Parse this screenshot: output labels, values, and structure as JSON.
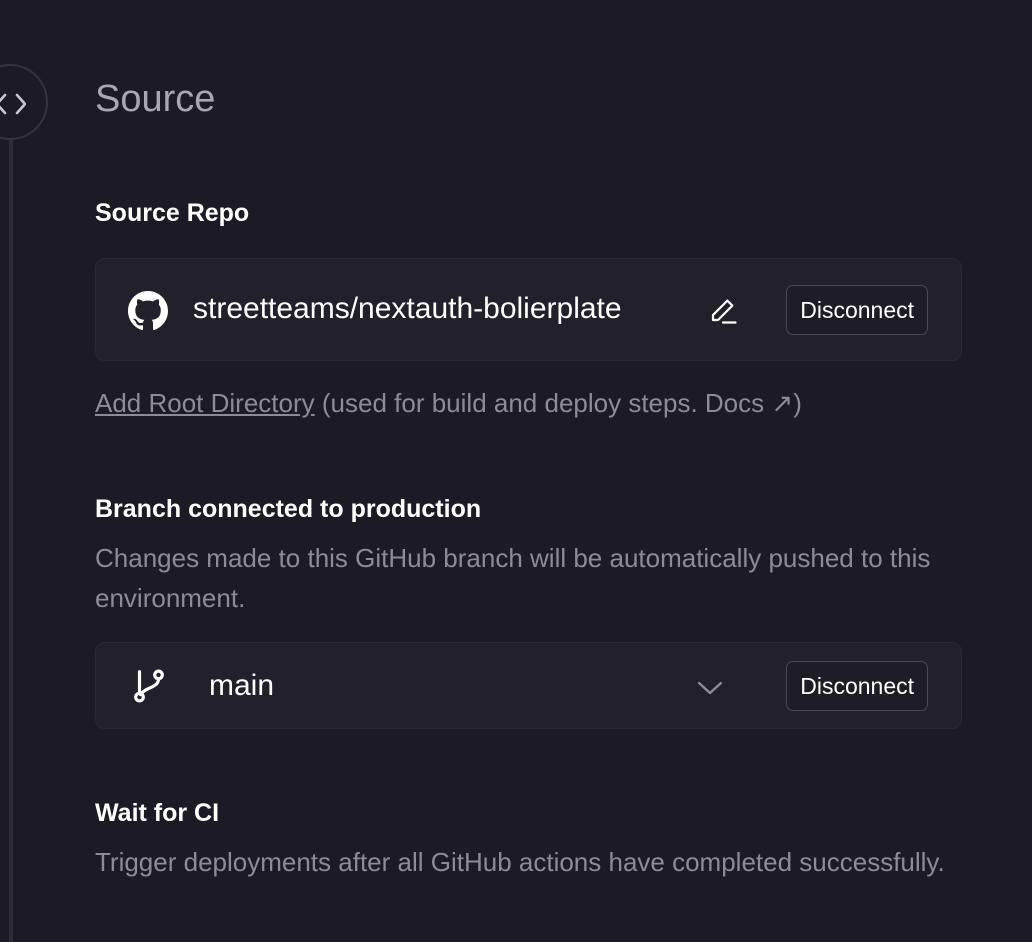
{
  "section": {
    "title": "Source",
    "icon": "code-brackets-icon"
  },
  "source_repo": {
    "label": "Source Repo",
    "repo_name": "streetteams/nextauth-bolierplate",
    "disconnect_label": "Disconnect",
    "icons": [
      "github-icon",
      "edit-pencil-icon"
    ]
  },
  "root_directory": {
    "link_label": "Add Root Directory",
    "suffix_text": "(used for build and deploy steps. Docs",
    "docs_arrow": "↗",
    "close_paren": ")"
  },
  "branch": {
    "label": "Branch connected to production",
    "description": "Changes made to this GitHub branch will be automatically pushed to this environment.",
    "selected": "main",
    "disconnect_label": "Disconnect",
    "icons": [
      "git-branch-icon",
      "chevron-down-icon"
    ]
  },
  "ci": {
    "label": "Wait for CI",
    "description": "Trigger deployments after all GitHub actions have completed successfully."
  },
  "colors": {
    "background": "#1c1a24",
    "card": "#22202b",
    "muted_text": "#8e8b98",
    "title_text": "#a9a6b4"
  }
}
